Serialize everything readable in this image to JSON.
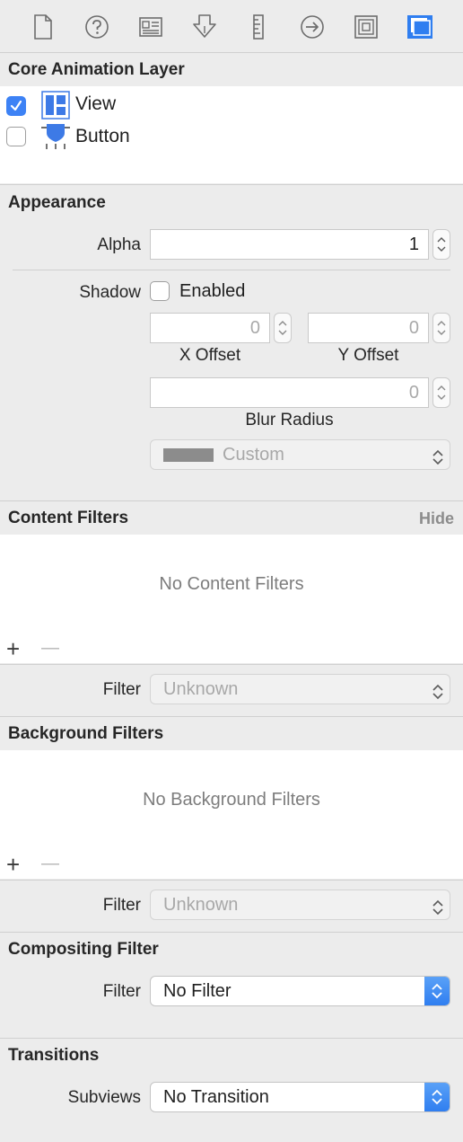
{
  "toolbar": {
    "icons": [
      "file-icon",
      "help-icon",
      "identity-icon",
      "attributes-icon",
      "size-ruler-icon",
      "connections-icon",
      "bindings-icon",
      "view-effects-icon"
    ],
    "active_index": 7,
    "accent_color": "#2f7ef0"
  },
  "core_animation": {
    "title": "Core Animation Layer",
    "rows": [
      {
        "label": "View",
        "checked": true
      },
      {
        "label": "Button",
        "checked": false
      }
    ]
  },
  "appearance": {
    "title": "Appearance",
    "alpha_label": "Alpha",
    "alpha_value": "1",
    "shadow_label": "Shadow",
    "shadow_enabled_label": "Enabled",
    "x_offset_value": "0",
    "x_offset_label": "X Offset",
    "y_offset_value": "0",
    "y_offset_label": "Y Offset",
    "blur_value": "0",
    "blur_label": "Blur Radius",
    "color_value": "Custom"
  },
  "content_filters": {
    "title": "Content Filters",
    "hide_label": "Hide",
    "empty_text": "No Content Filters",
    "add_label": "+",
    "remove_label": "—",
    "filter_label": "Filter",
    "filter_value": "Unknown"
  },
  "background_filters": {
    "title": "Background Filters",
    "empty_text": "No Background Filters",
    "add_label": "+",
    "remove_label": "—",
    "filter_label": "Filter",
    "filter_value": "Unknown"
  },
  "compositing_filter": {
    "title": "Compositing Filter",
    "filter_label": "Filter",
    "filter_value": "No Filter"
  },
  "transitions": {
    "title": "Transitions",
    "subviews_label": "Subviews",
    "subviews_value": "No Transition"
  }
}
